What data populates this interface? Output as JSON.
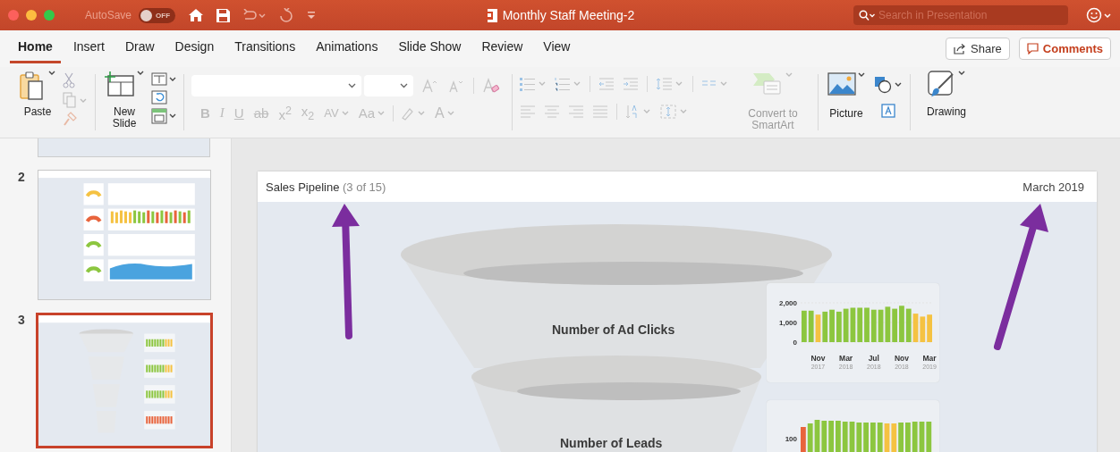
{
  "title_bar": {
    "autosave_label": "AutoSave",
    "autosave_toggle": {
      "on": false,
      "label": "OFF"
    },
    "document_title": "Monthly Staff Meeting-2",
    "search": {
      "placeholder": "Search in Presentation"
    }
  },
  "tabs": [
    {
      "label": "Home",
      "selected": true
    },
    {
      "label": "Insert",
      "selected": false
    },
    {
      "label": "Draw",
      "selected": false
    },
    {
      "label": "Design",
      "selected": false
    },
    {
      "label": "Transitions",
      "selected": false
    },
    {
      "label": "Animations",
      "selected": false
    },
    {
      "label": "Slide Show",
      "selected": false
    },
    {
      "label": "Review",
      "selected": false
    },
    {
      "label": "View",
      "selected": false
    }
  ],
  "share_button": "Share",
  "comments_button": "Comments",
  "ribbon": {
    "paste": "Paste",
    "new_slide": "New Slide",
    "format_buttons": [
      {
        "kind": "bold",
        "label": "B"
      },
      {
        "kind": "italic",
        "label": "I"
      },
      {
        "kind": "underline",
        "label": "U"
      },
      {
        "kind": "strike",
        "label": "ab"
      },
      {
        "kind": "superscript",
        "label": "x$^{2}$"
      },
      {
        "kind": "subscript",
        "label": "x$_{2}$"
      },
      {
        "kind": "spacing",
        "label": "AV"
      },
      {
        "kind": "case",
        "label": "Aa"
      }
    ],
    "font_color": "A",
    "convert_smartart": "Convert to SmartArt",
    "picture": "Picture",
    "drawing": "Drawing"
  },
  "thumbnails": [
    {
      "number": "2",
      "selected": false
    },
    {
      "number": "3",
      "selected": true
    }
  ],
  "slide": {
    "title": "Sales Pipeline",
    "counter": "(3 of 15)",
    "date": "March 2019",
    "funnel_stages": [
      "Number of Ad Clicks",
      "Number of Leads"
    ],
    "ad_clicks_chart": {
      "chart_data": {
        "type": "bar",
        "ylim": [
          0,
          2000
        ],
        "yticks": [
          {
            "value": 0,
            "label": "0"
          },
          {
            "value": 1000,
            "label": "1,000"
          },
          {
            "value": 2000,
            "label": "2,000"
          }
        ],
        "stacked": true,
        "categories": [
          null,
          null,
          "Nov 2017",
          null,
          null,
          null,
          "Mar 2018",
          null,
          null,
          null,
          "Jul 2018",
          null,
          null,
          null,
          "Nov 2018",
          null,
          null,
          null,
          "Mar 2019"
        ],
        "series": [
          {
            "color": "#8cc63f",
            "values": [
              1600,
              1600,
              null,
              1550,
              1650,
              1550,
              1700,
              1750,
              1750,
              1750,
              1650,
              1650,
              1800,
              1700,
              1850,
              1700,
              null,
              null,
              null
            ]
          },
          {
            "color": "#f5c242",
            "values": [
              null,
              null,
              1400,
              null,
              null,
              null,
              null,
              null,
              null,
              null,
              null,
              null,
              null,
              null,
              null,
              null,
              1450,
              1300,
              1400
            ]
          }
        ]
      }
    },
    "leads_chart": {
      "tick_label": "100"
    }
  }
}
